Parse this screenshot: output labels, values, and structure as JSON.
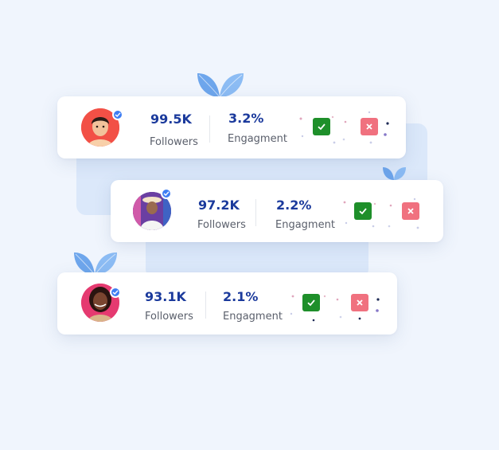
{
  "colors": {
    "accent_blue": "#1b3a9c",
    "accept_green": "#1e8f2a",
    "reject_red": "#f0717f",
    "verified_blue": "#3f7ef3",
    "background": "#f0f5fd"
  },
  "influencers": [
    {
      "followers": "99.5K",
      "followers_label": "Followers",
      "engagement": "3.2%",
      "engagement_label": "Engagment"
    },
    {
      "followers": "97.2K",
      "followers_label": "Followers",
      "engagement": "2.2%",
      "engagement_label": "Engagment"
    },
    {
      "followers": "93.1K",
      "followers_label": "Followers",
      "engagement": "2.1%",
      "engagement_label": "Engagment"
    }
  ],
  "icons": {
    "verified": "verified-badge-icon",
    "accept": "checkmark-icon",
    "reject": "close-icon",
    "decor": "leaf-icon"
  }
}
